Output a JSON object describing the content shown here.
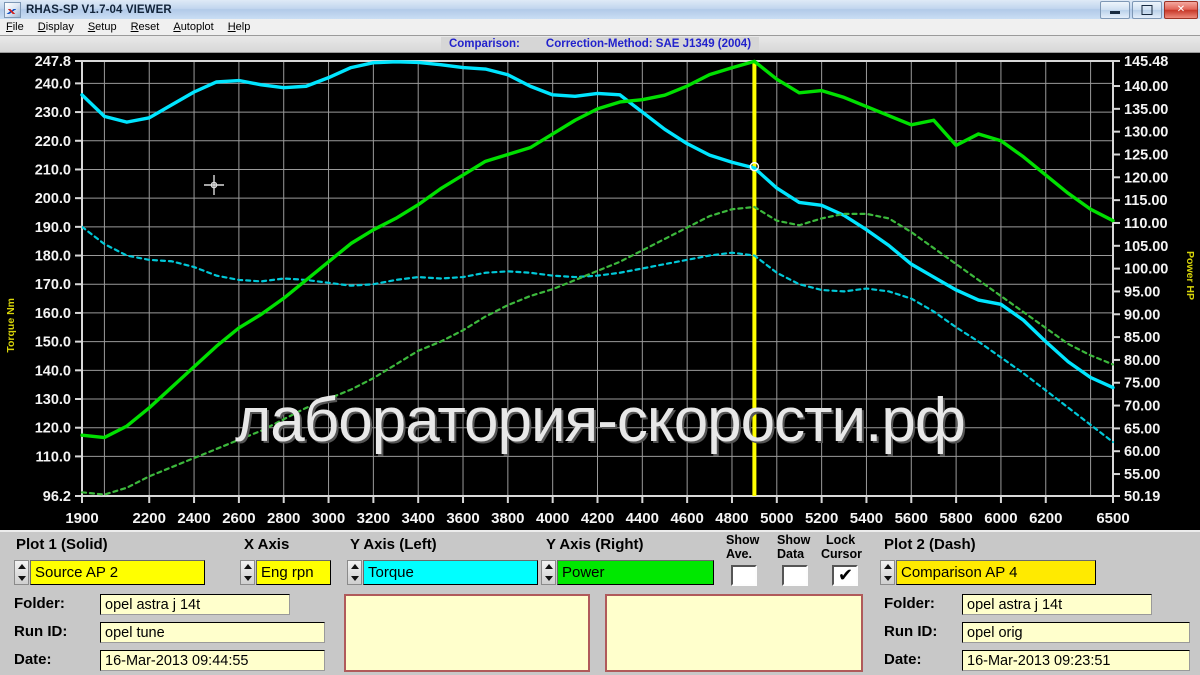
{
  "window": {
    "title": "RHAS-SP V1.7-04  VIEWER",
    "icon": "app-chart-icon",
    "buttons": {
      "minimize": "–",
      "maximize": "□",
      "close": "✕"
    }
  },
  "menu": [
    "File",
    "Display",
    "Setup",
    "Reset",
    "Autoplot",
    "Help"
  ],
  "header": {
    "comparison_label": "Comparison:",
    "correction_label": "Correction-Method: SAE J1349 (2004)",
    "color": "#2222cc"
  },
  "watermark": "лаборатория-скорости.рф",
  "controls": {
    "plot1_label": "Plot 1 (Solid)",
    "plot1_value": "Source AP 2",
    "xaxis_label": "X Axis",
    "xaxis_value": "Eng rpn",
    "yleft_label": "Y Axis (Left)",
    "yleft_value": "Torque",
    "yright_label": "Y Axis (Right)",
    "yright_value": "Power",
    "show_ave_label_1": "Show",
    "show_ave_label_2": "Ave.",
    "show_data_label_1": "Show",
    "show_data_label_2": "Data",
    "lock_cursor_label_1": "Lock",
    "lock_cursor_label_2": "Cursor",
    "show_ave_checked": false,
    "show_data_checked": false,
    "lock_cursor_checked": true,
    "checkmark": "✔",
    "plot2_label": "Plot 2 (Dash)",
    "plot2_value": "Comparison AP 4"
  },
  "run_left": {
    "folder_label": "Folder:",
    "folder_value": "opel astra j 14t",
    "runid_label": "Run ID:",
    "runid_value": "opel tune",
    "date_label": "Date:",
    "date_value": "16-Mar-2013  09:44:55"
  },
  "run_right": {
    "folder_label": "Folder:",
    "folder_value": "opel astra j 14t",
    "runid_label": "Run ID:",
    "runid_value": "opel orig",
    "date_label": "Date:",
    "date_value": "16-Mar-2013  09:23:51"
  },
  "chart_data": {
    "type": "line",
    "title": "",
    "xlabel": "Eng rpm",
    "ylabel": "Torque Nm",
    "y2label": "Power HP",
    "grid": true,
    "legend": "none",
    "background": "#000000",
    "xlim": [
      1900,
      6500
    ],
    "ylim": [
      96.2,
      247.8
    ],
    "y2lim": [
      50.19,
      145.48
    ],
    "xticks": [
      1900,
      2200,
      2400,
      2600,
      2800,
      3000,
      3200,
      3400,
      3600,
      3800,
      4000,
      4200,
      4400,
      4600,
      4800,
      5000,
      5200,
      5400,
      5600,
      5800,
      6000,
      6200,
      6500
    ],
    "yticks": [
      247.8,
      240.0,
      230.0,
      220.0,
      210.0,
      200.0,
      190.0,
      180.0,
      170.0,
      160.0,
      150.0,
      140.0,
      130.0,
      120.0,
      110.0,
      96.2
    ],
    "y2ticks": [
      145.48,
      140.0,
      135.0,
      130.0,
      125.0,
      120.0,
      115.0,
      110.0,
      105.0,
      100.0,
      95.0,
      90.0,
      85.0,
      80.0,
      75.0,
      70.0,
      65.0,
      60.0,
      55.0,
      50.19
    ],
    "cursor": {
      "x": 4900,
      "color": "#ffff00",
      "marker_y_torque": 211.0
    },
    "x": [
      1900,
      2000,
      2100,
      2200,
      2300,
      2400,
      2500,
      2600,
      2700,
      2800,
      2900,
      3000,
      3100,
      3200,
      3300,
      3400,
      3500,
      3600,
      3700,
      3800,
      3900,
      4000,
      4100,
      4200,
      4300,
      4400,
      4500,
      4600,
      4700,
      4800,
      4900,
      5000,
      5100,
      5200,
      5300,
      5400,
      5500,
      5600,
      5700,
      5800,
      5900,
      6000,
      6100,
      6200,
      6300,
      6400,
      6500
    ],
    "series": [
      {
        "name": "Torque (Source AP 2)",
        "axis": "left",
        "unit": "Nm",
        "color": "#00e5ff",
        "style": "solid",
        "values": [
          236.0,
          228.5,
          226.5,
          228.0,
          232.5,
          237.0,
          240.5,
          241.0,
          239.5,
          238.5,
          239.0,
          242.0,
          245.5,
          247.2,
          247.5,
          247.3,
          246.5,
          245.5,
          245.0,
          243.0,
          239.0,
          236.0,
          235.5,
          236.5,
          236.0,
          230.0,
          224.0,
          219.0,
          215.0,
          212.5,
          210.5,
          203.5,
          198.5,
          197.5,
          194.0,
          189.0,
          183.5,
          177.0,
          172.5,
          168.0,
          164.5,
          163.0,
          157.5,
          150.0,
          143.0,
          137.5,
          134.0
        ]
      },
      {
        "name": "Torque (Comparison AP 4)",
        "axis": "left",
        "unit": "Nm",
        "color": "#00c8d8",
        "style": "dash",
        "values": [
          190.0,
          184.0,
          180.0,
          178.5,
          178.0,
          176.0,
          173.0,
          171.5,
          171.0,
          172.0,
          171.5,
          170.5,
          169.5,
          170.0,
          171.5,
          172.5,
          172.0,
          172.5,
          174.0,
          174.5,
          174.0,
          173.0,
          172.5,
          173.0,
          174.0,
          175.5,
          177.0,
          178.5,
          180.0,
          181.0,
          180.0,
          174.0,
          170.0,
          168.0,
          167.5,
          168.5,
          167.5,
          165.0,
          160.5,
          155.0,
          150.0,
          144.5,
          139.0,
          133.0,
          127.0,
          121.0,
          115.0
        ]
      },
      {
        "name": "Power (Source AP 2)",
        "axis": "right",
        "unit": "HP",
        "color": "#00e000",
        "style": "solid",
        "values": [
          63.5,
          63.0,
          65.5,
          69.5,
          74.0,
          78.5,
          83.0,
          87.0,
          90.0,
          93.5,
          97.5,
          101.5,
          105.5,
          108.5,
          111.0,
          114.0,
          117.5,
          120.5,
          123.5,
          125.0,
          126.5,
          129.5,
          132.5,
          135.0,
          136.5,
          137.0,
          138.0,
          140.0,
          142.5,
          144.0,
          145.4,
          141.5,
          138.5,
          139.0,
          137.5,
          135.5,
          133.5,
          131.5,
          132.5,
          127.0,
          129.5,
          128.0,
          124.5,
          120.5,
          116.5,
          113.0,
          110.5
        ]
      },
      {
        "name": "Power (Comparison AP 4)",
        "axis": "right",
        "unit": "HP",
        "color": "#3cb83c",
        "style": "dash",
        "values": [
          51.0,
          50.5,
          52.0,
          54.5,
          56.5,
          58.5,
          60.5,
          62.5,
          64.5,
          67.0,
          69.5,
          71.5,
          73.5,
          76.0,
          79.0,
          82.0,
          84.0,
          86.5,
          89.5,
          92.0,
          94.0,
          95.5,
          97.5,
          99.5,
          101.5,
          104.0,
          106.5,
          109.0,
          111.5,
          113.0,
          113.5,
          110.5,
          109.5,
          111.0,
          112.0,
          112.0,
          111.0,
          108.0,
          104.5,
          101.0,
          97.5,
          94.0,
          90.5,
          87.0,
          83.5,
          81.0,
          79.0
        ]
      }
    ]
  }
}
